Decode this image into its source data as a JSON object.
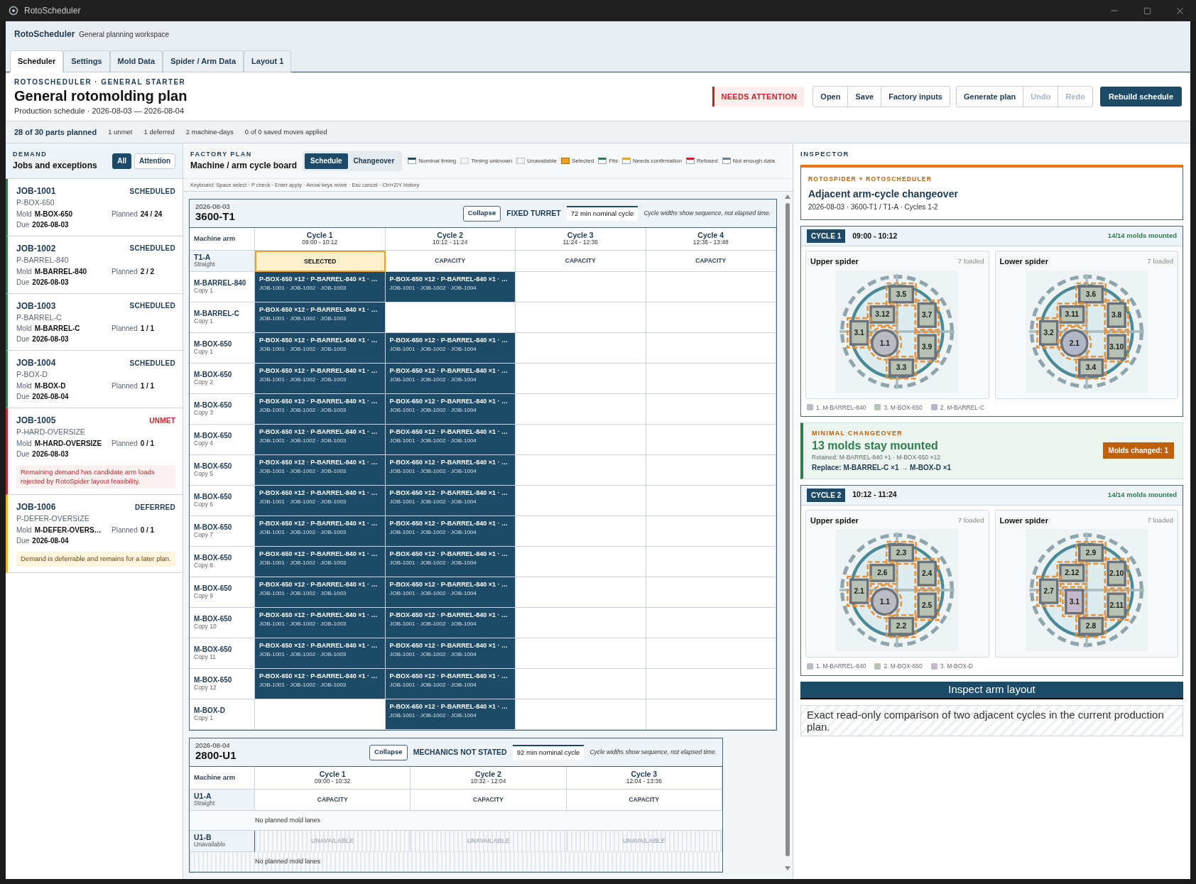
{
  "window": {
    "title": "RotoScheduler"
  },
  "app_header": {
    "name": "RotoScheduler",
    "subtitle": "General planning workspace"
  },
  "tabs": [
    {
      "label": "Scheduler",
      "selected": true
    },
    {
      "label": "Settings",
      "selected": false
    },
    {
      "label": "Mold Data",
      "selected": false
    },
    {
      "label": "Spider / Arm Data",
      "selected": false
    },
    {
      "label": "Layout 1",
      "selected": false
    }
  ],
  "page": {
    "eyebrow": "ROTOSCHEDULER · GENERAL STARTER",
    "title": "General rotomolding plan",
    "subtitle": "Production schedule · 2026-08-03 — 2026-08-04",
    "status": {
      "label": "NEEDS ATTENTION",
      "kind": "attention"
    },
    "button_groups": [
      [
        {
          "label": "Open",
          "disabled": false
        },
        {
          "label": "Save",
          "disabled": false
        },
        {
          "label": "Factory inputs",
          "disabled": false
        }
      ],
      [
        {
          "label": "Generate plan",
          "disabled": false
        },
        {
          "label": "Undo",
          "disabled": true
        },
        {
          "label": "Redo",
          "disabled": true
        }
      ]
    ],
    "primary_button": "Rebuild schedule"
  },
  "stats": [
    {
      "text": "28 of 30 parts planned",
      "emphasis": true
    },
    {
      "text": "1 unmet",
      "emphasis": false
    },
    {
      "text": "1 deferred",
      "emphasis": false
    },
    {
      "text": "2 machine-days",
      "emphasis": false
    },
    {
      "text": "0 of 0 saved moves applied",
      "emphasis": false
    }
  ],
  "demand": {
    "eyebrow": "DEMAND",
    "title": "Jobs and exceptions",
    "filters": [
      {
        "label": "All",
        "selected": true
      },
      {
        "label": "Attention",
        "selected": false
      }
    ],
    "jobs": [
      {
        "id": "JOB-1001",
        "status": "SCHEDULED",
        "kind": "scheduled",
        "part": "P-BOX-650",
        "fields": [
          {
            "label": "Mold",
            "value": "M-BOX-650"
          },
          {
            "label": "Planned",
            "value": "24 / 24"
          },
          {
            "label": "Due",
            "value": "2026-08-03"
          }
        ]
      },
      {
        "id": "JOB-1002",
        "status": "SCHEDULED",
        "kind": "scheduled",
        "part": "P-BARREL-840",
        "fields": [
          {
            "label": "Mold",
            "value": "M-BARREL-840"
          },
          {
            "label": "Planned",
            "value": "2 / 2"
          },
          {
            "label": "Due",
            "value": "2026-08-03"
          }
        ]
      },
      {
        "id": "JOB-1003",
        "status": "SCHEDULED",
        "kind": "scheduled",
        "part": "P-BARREL-C",
        "fields": [
          {
            "label": "Mold",
            "value": "M-BARREL-C"
          },
          {
            "label": "Planned",
            "value": "1 / 1"
          },
          {
            "label": "Due",
            "value": "2026-08-03"
          }
        ]
      },
      {
        "id": "JOB-1004",
        "status": "SCHEDULED",
        "kind": "scheduled",
        "part": "P-BOX-D",
        "fields": [
          {
            "label": "Mold",
            "value": "M-BOX-D"
          },
          {
            "label": "Planned",
            "value": "1 / 1"
          },
          {
            "label": "Due",
            "value": "2026-08-04"
          }
        ]
      },
      {
        "id": "JOB-1005",
        "status": "UNMET",
        "kind": "unmet",
        "part": "P-HARD-OVERSIZE",
        "fields": [
          {
            "label": "Mold",
            "value": "M-HARD-OVERSIZE"
          },
          {
            "label": "Planned",
            "value": "0 / 1"
          },
          {
            "label": "Due",
            "value": "2026-08-03"
          }
        ],
        "note": "Remaining demand has candidate arm loads rejected by RotoSpider layout feasibility."
      },
      {
        "id": "JOB-1006",
        "status": "DEFERRED",
        "kind": "deferred",
        "part": "P-DEFER-OVERSIZE",
        "fields": [
          {
            "label": "Mold",
            "value": "M-DEFER-OVERS…"
          },
          {
            "label": "Planned",
            "value": "0 / 1"
          },
          {
            "label": "Due",
            "value": "2026-08-04"
          }
        ],
        "note": "Demand is deferrable and remains for a later plan."
      }
    ]
  },
  "factory_plan": {
    "eyebrow": "FACTORY PLAN",
    "title": "Machine / arm cycle board",
    "views": [
      {
        "label": "Schedule",
        "selected": true
      },
      {
        "label": "Changeover",
        "selected": false
      }
    ],
    "legend": [
      {
        "label": "Nominal timing",
        "kind": "nominal"
      },
      {
        "label": "Timing unknown",
        "kind": "unknown"
      },
      {
        "label": "Unavailable",
        "kind": "unavailable"
      },
      {
        "label": "Selected",
        "kind": "selected"
      },
      {
        "label": "Fits",
        "kind": "fits"
      },
      {
        "label": "Needs confirmation",
        "kind": "confirm"
      },
      {
        "label": "Refused",
        "kind": "refused"
      },
      {
        "label": "Not enough data",
        "kind": "nodata"
      }
    ],
    "keyboard_hint": "Keyboard: Space select · P check · Enter apply · Arrow keys move · Esc cancel · Ctrl+Z/Y history",
    "boards": [
      {
        "date": "2026-08-03",
        "machine": "3600-T1",
        "collapse": "Collapse",
        "mechanics": "FIXED TURRET",
        "cycle_time": "72 min nominal cycle",
        "note": "Cycle widths show sequence, not elapsed time.",
        "arm_header": "Machine arm",
        "cycles": [
          {
            "name": "Cycle 1",
            "time": "09:00 - 10:12"
          },
          {
            "name": "Cycle 2",
            "time": "10:12 - 11:24"
          },
          {
            "name": "Cycle 3",
            "time": "11:24 - 12:36"
          },
          {
            "name": "Cycle 4",
            "time": "12:36 - 13:48"
          }
        ],
        "arms": [
          {
            "name": "T1-A",
            "sub": "Straight",
            "available": true,
            "cells": [
              {
                "label": "SELECTED",
                "selected": true
              },
              {
                "label": "CAPACITY",
                "selected": false
              },
              {
                "label": "CAPACITY",
                "selected": false
              },
              {
                "label": "CAPACITY",
                "selected": false
              }
            ],
            "lanes": [
              {
                "name": "M-BARREL-840",
                "copy": "Copy 1",
                "cells": [
                  {
                    "kind": "load",
                    "title": "P-BOX-650 ×12 · P-BARREL-840 ×1 · …",
                    "jobs": "JOB-1001 · JOB-1002 · JOB-1003"
                  },
                  {
                    "kind": "load",
                    "title": "P-BOX-650 ×12 · P-BARREL-840 ×1 · …",
                    "jobs": "JOB-1001 · JOB-1002 · JOB-1004"
                  },
                  {
                    "kind": "empty"
                  },
                  {
                    "kind": "empty"
                  }
                ]
              },
              {
                "name": "M-BARREL-C",
                "copy": "Copy 1",
                "cells": [
                  {
                    "kind": "load",
                    "title": "P-BOX-650 ×12 · P-BARREL-840 ×1 · …",
                    "jobs": "JOB-1001 · JOB-1002 · JOB-1003"
                  },
                  {
                    "kind": "empty"
                  },
                  {
                    "kind": "empty"
                  },
                  {
                    "kind": "empty"
                  }
                ]
              },
              {
                "name": "M-BOX-650",
                "copy": "Copy 1",
                "cells": [
                  {
                    "kind": "load",
                    "title": "P-BOX-650 ×12 · P-BARREL-840 ×1 · …",
                    "jobs": "JOB-1001 · JOB-1002 · JOB-1003"
                  },
                  {
                    "kind": "load",
                    "title": "P-BOX-650 ×12 · P-BARREL-840 ×1 · …",
                    "jobs": "JOB-1001 · JOB-1002 · JOB-1004"
                  },
                  {
                    "kind": "empty"
                  },
                  {
                    "kind": "empty"
                  }
                ]
              },
              {
                "name": "M-BOX-650",
                "copy": "Copy 2",
                "cells": [
                  {
                    "kind": "load",
                    "title": "P-BOX-650 ×12 · P-BARREL-840 ×1 · …",
                    "jobs": "JOB-1001 · JOB-1002 · JOB-1003"
                  },
                  {
                    "kind": "load",
                    "title": "P-BOX-650 ×12 · P-BARREL-840 ×1 · …",
                    "jobs": "JOB-1001 · JOB-1002 · JOB-1004"
                  },
                  {
                    "kind": "empty"
                  },
                  {
                    "kind": "empty"
                  }
                ]
              },
              {
                "name": "M-BOX-650",
                "copy": "Copy 3",
                "cells": [
                  {
                    "kind": "load",
                    "title": "P-BOX-650 ×12 · P-BARREL-840 ×1 · …",
                    "jobs": "JOB-1001 · JOB-1002 · JOB-1003"
                  },
                  {
                    "kind": "load",
                    "title": "P-BOX-650 ×12 · P-BARREL-840 ×1 · …",
                    "jobs": "JOB-1001 · JOB-1002 · JOB-1004"
                  },
                  {
                    "kind": "empty"
                  },
                  {
                    "kind": "empty"
                  }
                ]
              },
              {
                "name": "M-BOX-650",
                "copy": "Copy 4",
                "cells": [
                  {
                    "kind": "load",
                    "title": "P-BOX-650 ×12 · P-BARREL-840 ×1 · …",
                    "jobs": "JOB-1001 · JOB-1002 · JOB-1003"
                  },
                  {
                    "kind": "load",
                    "title": "P-BOX-650 ×12 · P-BARREL-840 ×1 · …",
                    "jobs": "JOB-1001 · JOB-1002 · JOB-1004"
                  },
                  {
                    "kind": "empty"
                  },
                  {
                    "kind": "empty"
                  }
                ]
              },
              {
                "name": "M-BOX-650",
                "copy": "Copy 5",
                "cells": [
                  {
                    "kind": "load",
                    "title": "P-BOX-650 ×12 · P-BARREL-840 ×1 · …",
                    "jobs": "JOB-1001 · JOB-1002 · JOB-1003"
                  },
                  {
                    "kind": "load",
                    "title": "P-BOX-650 ×12 · P-BARREL-840 ×1 · …",
                    "jobs": "JOB-1001 · JOB-1002 · JOB-1004"
                  },
                  {
                    "kind": "empty"
                  },
                  {
                    "kind": "empty"
                  }
                ]
              },
              {
                "name": "M-BOX-650",
                "copy": "Copy 6",
                "cells": [
                  {
                    "kind": "load",
                    "title": "P-BOX-650 ×12 · P-BARREL-840 ×1 · …",
                    "jobs": "JOB-1001 · JOB-1002 · JOB-1003"
                  },
                  {
                    "kind": "load",
                    "title": "P-BOX-650 ×12 · P-BARREL-840 ×1 · …",
                    "jobs": "JOB-1001 · JOB-1002 · JOB-1004"
                  },
                  {
                    "kind": "empty"
                  },
                  {
                    "kind": "empty"
                  }
                ]
              },
              {
                "name": "M-BOX-650",
                "copy": "Copy 7",
                "cells": [
                  {
                    "kind": "load",
                    "title": "P-BOX-650 ×12 · P-BARREL-840 ×1 · …",
                    "jobs": "JOB-1001 · JOB-1002 · JOB-1003"
                  },
                  {
                    "kind": "load",
                    "title": "P-BOX-650 ×12 · P-BARREL-840 ×1 · …",
                    "jobs": "JOB-1001 · JOB-1002 · JOB-1004"
                  },
                  {
                    "kind": "empty"
                  },
                  {
                    "kind": "empty"
                  }
                ]
              },
              {
                "name": "M-BOX-650",
                "copy": "Copy 8",
                "cells": [
                  {
                    "kind": "load",
                    "title": "P-BOX-650 ×12 · P-BARREL-840 ×1 · …",
                    "jobs": "JOB-1001 · JOB-1002 · JOB-1003"
                  },
                  {
                    "kind": "load",
                    "title": "P-BOX-650 ×12 · P-BARREL-840 ×1 · …",
                    "jobs": "JOB-1001 · JOB-1002 · JOB-1004"
                  },
                  {
                    "kind": "empty"
                  },
                  {
                    "kind": "empty"
                  }
                ]
              },
              {
                "name": "M-BOX-650",
                "copy": "Copy 9",
                "cells": [
                  {
                    "kind": "load",
                    "title": "P-BOX-650 ×12 · P-BARREL-840 ×1 · …",
                    "jobs": "JOB-1001 · JOB-1002 · JOB-1003"
                  },
                  {
                    "kind": "load",
                    "title": "P-BOX-650 ×12 · P-BARREL-840 ×1 · …",
                    "jobs": "JOB-1001 · JOB-1002 · JOB-1004"
                  },
                  {
                    "kind": "empty"
                  },
                  {
                    "kind": "empty"
                  }
                ]
              },
              {
                "name": "M-BOX-650",
                "copy": "Copy 10",
                "cells": [
                  {
                    "kind": "load",
                    "title": "P-BOX-650 ×12 · P-BARREL-840 ×1 · …",
                    "jobs": "JOB-1001 · JOB-1002 · JOB-1003"
                  },
                  {
                    "kind": "load",
                    "title": "P-BOX-650 ×12 · P-BARREL-840 ×1 · …",
                    "jobs": "JOB-1001 · JOB-1002 · JOB-1004"
                  },
                  {
                    "kind": "empty"
                  },
                  {
                    "kind": "empty"
                  }
                ]
              },
              {
                "name": "M-BOX-650",
                "copy": "Copy 11",
                "cells": [
                  {
                    "kind": "load",
                    "title": "P-BOX-650 ×12 · P-BARREL-840 ×1 · …",
                    "jobs": "JOB-1001 · JOB-1002 · JOB-1003"
                  },
                  {
                    "kind": "load",
                    "title": "P-BOX-650 ×12 · P-BARREL-840 ×1 · …",
                    "jobs": "JOB-1001 · JOB-1002 · JOB-1004"
                  },
                  {
                    "kind": "empty"
                  },
                  {
                    "kind": "empty"
                  }
                ]
              },
              {
                "name": "M-BOX-650",
                "copy": "Copy 12",
                "cells": [
                  {
                    "kind": "load",
                    "title": "P-BOX-650 ×12 · P-BARREL-840 ×1 · …",
                    "jobs": "JOB-1001 · JOB-1002 · JOB-1003"
                  },
                  {
                    "kind": "load",
                    "title": "P-BOX-650 ×12 · P-BARREL-840 ×1 · …",
                    "jobs": "JOB-1001 · JOB-1002 · JOB-1004"
                  },
                  {
                    "kind": "empty"
                  },
                  {
                    "kind": "empty"
                  }
                ]
              },
              {
                "name": "M-BOX-D",
                "copy": "Copy 1",
                "cells": [
                  {
                    "kind": "empty"
                  },
                  {
                    "kind": "load",
                    "title": "P-BOX-650 ×12 · P-BARREL-840 ×1 · …",
                    "jobs": "JOB-1001 · JOB-1002 · JOB-1004"
                  },
                  {
                    "kind": "empty"
                  },
                  {
                    "kind": "empty"
                  }
                ]
              }
            ]
          }
        ]
      },
      {
        "date": "2026-08-04",
        "machine": "2800-U1",
        "collapse": "Collapse",
        "mechanics": "MECHANICS NOT STATED",
        "cycle_time": "92 min nominal cycle",
        "note": "Cycle widths show sequence, not elapsed time.",
        "arm_header": "Machine arm",
        "cycles": [
          {
            "name": "Cycle 1",
            "time": "09:00 - 10:32"
          },
          {
            "name": "Cycle 2",
            "time": "10:32 - 12:04"
          },
          {
            "name": "Cycle 3",
            "time": "12:04 - 13:36"
          }
        ],
        "arms": [
          {
            "name": "U1-A",
            "sub": "Straight",
            "available": true,
            "cells": [
              {
                "label": "CAPACITY",
                "selected": false
              },
              {
                "label": "CAPACITY",
                "selected": false
              },
              {
                "label": "CAPACITY",
                "selected": false
              }
            ],
            "empty_text": "No planned mold lanes"
          },
          {
            "name": "U1-B",
            "sub": "Unavailable",
            "available": false,
            "cells": [
              {
                "label": "UNAVAILABLE",
                "selected": false
              },
              {
                "label": "UNAVAILABLE",
                "selected": false
              },
              {
                "label": "UNAVAILABLE",
                "selected": false
              }
            ],
            "empty_text": "No planned mold lanes"
          }
        ]
      }
    ]
  },
  "inspector": {
    "eyebrow": "INSPECTOR",
    "card": {
      "eyebrow": "ROTOSPIDER + ROTOSCHEDULER",
      "title": "Adjacent arm-cycle changeover",
      "subtitle": "2026-08-03 · 3600-T1 / T1-A · Cycles 1-2"
    },
    "sections": [
      {
        "kind": "cycle",
        "badge": "CYCLE 1",
        "time": "09:00 - 10:12",
        "mounted": "14/14 molds mounted",
        "spiders": [
          {
            "name": "Upper spider",
            "count": "7 loaded",
            "slots": [
              {
                "label": "3.5",
                "kind": "rect",
                "color": "#b7c2b4"
              },
              {
                "label": "3.12",
                "kind": "rect",
                "color": "#b7c2b4"
              },
              {
                "label": "3.7",
                "kind": "rect",
                "color": "#b7c2b4"
              },
              {
                "label": "3.1",
                "kind": "rect",
                "color": "#b7c2b4"
              },
              {
                "label": "1.1",
                "kind": "round",
                "color": "#b9bcc4"
              },
              {
                "label": "3.9",
                "kind": "rect",
                "color": "#b7c2b4"
              },
              {
                "label": "3.3",
                "kind": "rect",
                "color": "#b7c2b4"
              }
            ]
          },
          {
            "name": "Lower spider",
            "count": "7 loaded",
            "slots": [
              {
                "label": "3.6",
                "kind": "rect",
                "color": "#b7c2b4"
              },
              {
                "label": "3.11",
                "kind": "rect",
                "color": "#b7c2b4"
              },
              {
                "label": "3.8",
                "kind": "rect",
                "color": "#b7c2b4"
              },
              {
                "label": "3.2",
                "kind": "rect",
                "color": "#b7c2b4"
              },
              {
                "label": "2.1",
                "kind": "round",
                "color": "#b3b8c8"
              },
              {
                "label": "3.10",
                "kind": "rect",
                "color": "#b7c2b4"
              },
              {
                "label": "3.4",
                "kind": "rect",
                "color": "#b7c2b4"
              }
            ]
          }
        ],
        "legend": [
          {
            "label": "1. M-BARREL-840",
            "color": "#b9bcc4"
          },
          {
            "label": "3. M-BOX-650",
            "color": "#b7c2b4"
          },
          {
            "label": "2. M-BARREL-C",
            "color": "#b3b8c8"
          }
        ]
      },
      {
        "kind": "changeover",
        "eyebrow": "MINIMAL CHANGEOVER",
        "title": "13 molds stay mounted",
        "retained": "Retained: M-BARREL-840 ×1 · M-BOX-650 ×12",
        "replace": "Replace: M-BARREL-C ×1 → M-BOX-D ×1",
        "badge": "Molds changed: 1"
      },
      {
        "kind": "cycle",
        "badge": "CYCLE 2",
        "time": "10:12 - 11:24",
        "mounted": "14/14 molds mounted",
        "spiders": [
          {
            "name": "Upper spider",
            "count": "7 loaded",
            "slots": [
              {
                "label": "2.3",
                "kind": "rect",
                "color": "#b7c2b4"
              },
              {
                "label": "2.6",
                "kind": "rect",
                "color": "#b7c2b4"
              },
              {
                "label": "2.4",
                "kind": "rect",
                "color": "#b7c2b4"
              },
              {
                "label": "2.1",
                "kind": "rect",
                "color": "#b7c2b4"
              },
              {
                "label": "1.1",
                "kind": "round",
                "color": "#b9bcc4"
              },
              {
                "label": "2.5",
                "kind": "rect",
                "color": "#b7c2b4"
              },
              {
                "label": "2.2",
                "kind": "rect",
                "color": "#b7c2b4"
              }
            ]
          },
          {
            "name": "Lower spider",
            "count": "7 loaded",
            "slots": [
              {
                "label": "2.9",
                "kind": "rect",
                "color": "#b7c2b4"
              },
              {
                "label": "2.12",
                "kind": "rect",
                "color": "#b7c2b4"
              },
              {
                "label": "2.10",
                "kind": "rect",
                "color": "#b7c2b4"
              },
              {
                "label": "2.7",
                "kind": "rect",
                "color": "#b7c2b4"
              },
              {
                "label": "3.1",
                "kind": "rect",
                "color": "#c4b8cc"
              },
              {
                "label": "2.11",
                "kind": "rect",
                "color": "#b7c2b4"
              },
              {
                "label": "2.8",
                "kind": "rect",
                "color": "#b7c2b4"
              }
            ]
          }
        ],
        "legend": [
          {
            "label": "1. M-BARREL-840",
            "color": "#b9bcc4"
          },
          {
            "label": "2. M-BOX-650",
            "color": "#b7c2b4"
          },
          {
            "label": "3. M-BOX-D",
            "color": "#c4b8cc"
          }
        ]
      }
    ],
    "action": "Inspect arm layout",
    "note": "Exact read-only comparison of two adjacent cycles in the current production plan."
  }
}
